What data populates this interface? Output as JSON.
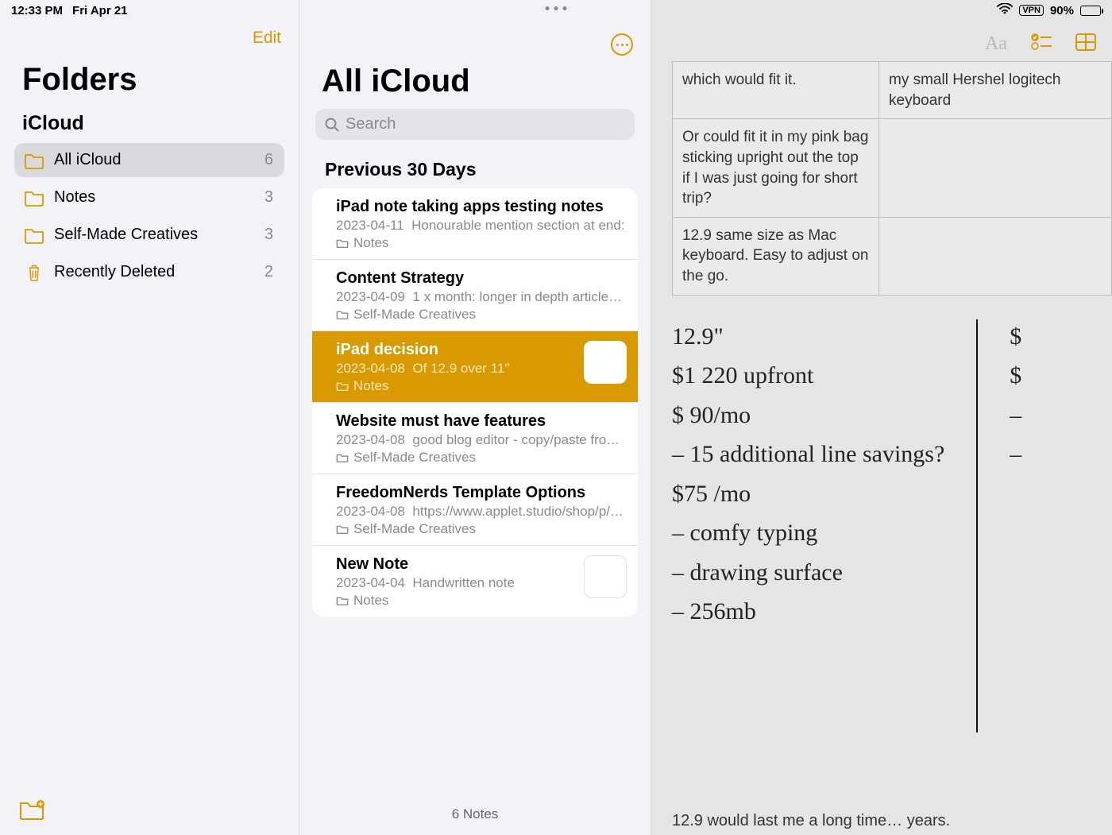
{
  "status": {
    "time": "12:33 PM",
    "date": "Fri Apr 21",
    "vpn": "VPN",
    "battery_pct": "90%"
  },
  "folders_panel": {
    "edit": "Edit",
    "title": "Folders",
    "section": "iCloud",
    "items": [
      {
        "label": "All iCloud",
        "count": "6",
        "selected": true,
        "icon": "folder"
      },
      {
        "label": "Notes",
        "count": "3",
        "selected": false,
        "icon": "folder"
      },
      {
        "label": "Self-Made Creatives",
        "count": "3",
        "selected": false,
        "icon": "folder"
      },
      {
        "label": "Recently Deleted",
        "count": "2",
        "selected": false,
        "icon": "trash"
      }
    ]
  },
  "list_panel": {
    "title": "All iCloud",
    "search_placeholder": "Search",
    "section_header": "Previous 30 Days",
    "notes": [
      {
        "title": "iPad note taking apps testing notes",
        "date": "2023-04-11",
        "preview": "Honourable mention section at end:",
        "folder": "Notes",
        "selected": false,
        "thumb": false
      },
      {
        "title": "Content Strategy",
        "date": "2023-04-09",
        "preview": "1 x month: longer in depth article…",
        "folder": "Self-Made Creatives",
        "selected": false,
        "thumb": false
      },
      {
        "title": "iPad decision",
        "date": "2023-04-08",
        "preview": "Of 12.9 over 11\"",
        "folder": "Notes",
        "selected": true,
        "thumb": true
      },
      {
        "title": "Website must have features",
        "date": "2023-04-08",
        "preview": "good blog editor - copy/paste fro…",
        "folder": "Self-Made Creatives",
        "selected": false,
        "thumb": false
      },
      {
        "title": "FreedomNerds Template Options",
        "date": "2023-04-08",
        "preview": "https://www.applet.studio/shop/p/…",
        "folder": "Self-Made Creatives",
        "selected": false,
        "thumb": false
      },
      {
        "title": "New Note",
        "date": "2023-04-04",
        "preview": "Handwritten note",
        "folder": "Notes",
        "selected": false,
        "thumb": true
      }
    ],
    "footer": "6 Notes"
  },
  "note_panel": {
    "toolbar": {
      "text_style": "Aa"
    },
    "table_rows": [
      {
        "a": "which would fit it.",
        "b": "my small Hershel logitech keyboard"
      },
      {
        "a": "Or could fit it in my pink bag sticking upright out the top if I was just going for short trip?",
        "b": ""
      },
      {
        "a": "12.9 same size as Mac keyboard. Easy to adjust on the go.",
        "b": ""
      }
    ],
    "hand_left": [
      "12.9\"",
      "$1 220 upfront",
      "$ 90/mo",
      "– 15 additional line savings?",
      "$75 /mo",
      "– comfy typing",
      "– drawing surface",
      "– 256mb"
    ],
    "hand_right": [
      "$",
      "$",
      "–",
      "–"
    ],
    "bottom_text": "12.9 would last me a long time… years."
  }
}
